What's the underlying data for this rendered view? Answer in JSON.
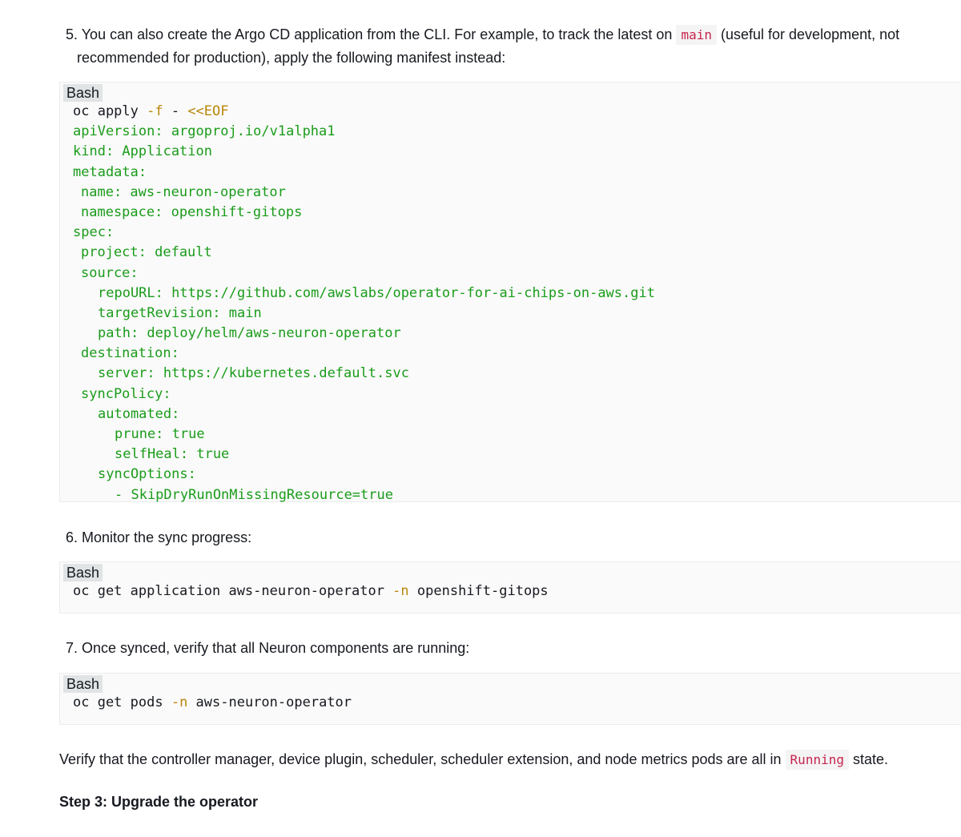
{
  "steps": {
    "s5": {
      "number": "5.",
      "text_before": "You can also create the Argo CD application from the CLI. For example, to track the latest on",
      "code": "main",
      "text_after": "(useful for development, not",
      "text_cont": "recommended for production), apply the following manifest instead:"
    },
    "s6": {
      "number": "6.",
      "text": "Monitor the sync progress:"
    },
    "s7": {
      "number": "7.",
      "text": "Once synced, verify that all Neuron components are running:"
    }
  },
  "blocks": {
    "b1": {
      "lang": "Bash",
      "lines": {
        "l1": {
          "cmd": "oc apply ",
          "flag": "-f",
          "rest": " - ",
          "heredoc": "<<EOF"
        },
        "l2": "apiVersion: argoproj.io/v1alpha1",
        "l3": "kind: Application",
        "l4": "metadata:",
        "l5": "name: aws-neuron-operator",
        "l6": "namespace: openshift-gitops",
        "l7": "spec:",
        "l8": "project: default",
        "l9": "source:",
        "l10": "repoURL: https://github.com/awslabs/operator-for-ai-chips-on-aws.git",
        "l11": "targetRevision: main",
        "l12": "path: deploy/helm/aws-neuron-operator",
        "l13": "destination:",
        "l14": "server: https://kubernetes.default.svc",
        "l15": "syncPolicy:",
        "l16": "automated:",
        "l17": "prune: true",
        "l18": "selfHeal: true",
        "l19": "syncOptions:",
        "l20": "- SkipDryRunOnMissingResource=true"
      }
    },
    "b2": {
      "lang": "Bash",
      "cmd": "oc get application aws-neuron-operator ",
      "flag": "-n",
      "rest": " openshift-gitops"
    },
    "b3": {
      "lang": "Bash",
      "cmd": "oc get pods ",
      "flag": "-n",
      "rest": " aws-neuron-operator"
    }
  },
  "verify": {
    "text_before": "Verify that the controller manager, device plugin, scheduler, scheduler extension, and node metrics pods are all in",
    "code": "Running",
    "text_after": "state."
  },
  "heading": "Step 3: Upgrade the operator",
  "colors": {
    "yaml_green": "#1a9c1a",
    "flag_orange": "#b8860b",
    "inline_code_red": "#c7254e"
  }
}
